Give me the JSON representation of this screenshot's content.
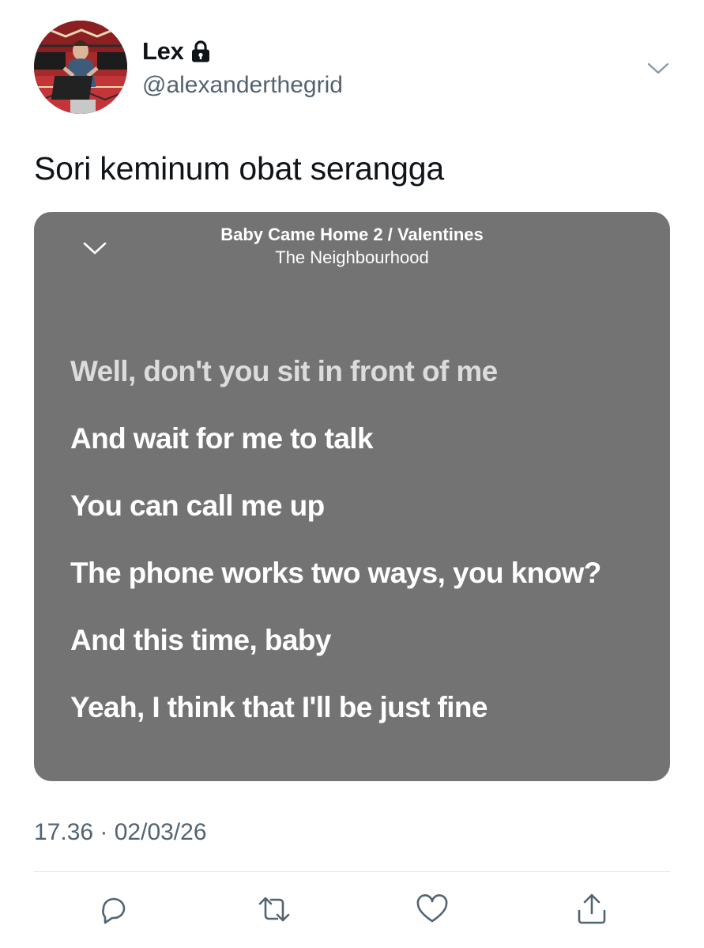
{
  "author": {
    "display_name": "Lex",
    "handle": "@alexanderthegrid"
  },
  "tweet": {
    "text": "Sori keminum obat serangga",
    "timestamp": "17.36 · 02/03/26"
  },
  "lyrics_card": {
    "song_title": "Baby Came Home 2 / Valentines",
    "artist": "The Neighbourhood",
    "background_color": "#737373",
    "lines": [
      {
        "text": "Well, don't you sit in front of me",
        "style": "dim"
      },
      {
        "text": "And wait for me to talk",
        "style": "bright"
      },
      {
        "text": "You can call me up",
        "style": "bright"
      },
      {
        "text": "The phone works two ways, you know?",
        "style": "bright"
      },
      {
        "text": "And this time, baby",
        "style": "bright"
      },
      {
        "text": "Yeah, I think that I'll be just fine",
        "style": "bright"
      }
    ]
  },
  "icons": {
    "lock": "lock-icon",
    "more": "chevron-down-icon",
    "card_collapse": "chevron-down-icon",
    "reply": "reply-icon",
    "retweet": "retweet-icon",
    "like": "heart-icon",
    "share": "share-icon"
  },
  "colors": {
    "text_primary": "#0f1419",
    "text_secondary": "#536471",
    "icon_action": "#536471"
  }
}
